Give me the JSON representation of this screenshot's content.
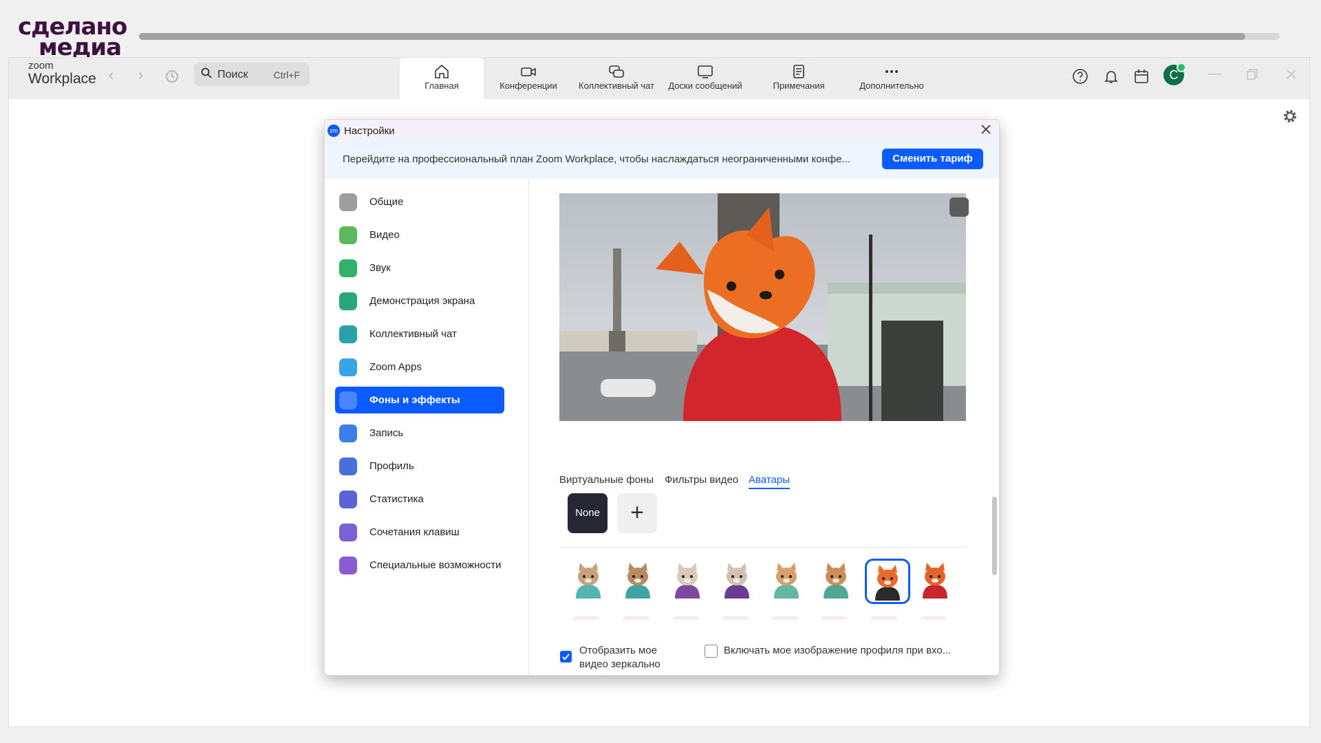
{
  "watermark": {
    "line1": "сделано",
    "line2": "медиа"
  },
  "video_progress": 0.97,
  "app": {
    "brand_small": "zoom",
    "brand_big": "Workplace"
  },
  "search": {
    "placeholder": "Поиск",
    "shortcut": "Ctrl+F"
  },
  "tabs": [
    {
      "label": "Главная",
      "icon": "home-icon"
    },
    {
      "label": "Конференции",
      "icon": "video-camera-icon"
    },
    {
      "label": "Коллективный чат",
      "icon": "chat-icon"
    },
    {
      "label": "Доски сообщений",
      "icon": "whiteboard-icon"
    },
    {
      "label": "Примечания",
      "icon": "notes-icon"
    },
    {
      "label": "Дополнительно",
      "icon": "more-icon"
    }
  ],
  "user": {
    "initial": "C"
  },
  "dialog": {
    "title": "Настройки",
    "banner_text": "Перейдите на профессиональный план Zoom Workplace, чтобы наслаждаться неограниченными конфе...",
    "upgrade_button": "Сменить тариф"
  },
  "sidebar": [
    {
      "label": "Общие",
      "icon": "gear-icon",
      "color": "#9e9e9e"
    },
    {
      "label": "Видео",
      "icon": "video-icon",
      "color": "#5cb85c"
    },
    {
      "label": "Звук",
      "icon": "headphones-icon",
      "color": "#2fb36b"
    },
    {
      "label": "Демонстрация экрана",
      "icon": "screen-share-icon",
      "color": "#27a878"
    },
    {
      "label": "Коллективный чат",
      "icon": "chat-icon",
      "color": "#2aa0a8"
    },
    {
      "label": "Zoom Apps",
      "icon": "apps-icon",
      "color": "#3aa3e8"
    },
    {
      "label": "Фоны и эффекты",
      "icon": "background-icon",
      "color": "#0b5cff",
      "active": true
    },
    {
      "label": "Запись",
      "icon": "record-icon",
      "color": "#3d7fe8"
    },
    {
      "label": "Профиль",
      "icon": "profile-icon",
      "color": "#4a6fd8"
    },
    {
      "label": "Статистика",
      "icon": "statistics-icon",
      "color": "#5b63d8"
    },
    {
      "label": "Сочетания клавиш",
      "icon": "keyboard-icon",
      "color": "#7a62d6"
    },
    {
      "label": "Специальные возможности",
      "icon": "accessibility-icon",
      "color": "#8a5ad0"
    }
  ],
  "bg_tabs": [
    {
      "label": "Виртуальные фоны"
    },
    {
      "label": "Фильтры видео"
    },
    {
      "label": "Аватары",
      "active": true
    }
  ],
  "avatar_none": "None",
  "avatars": [
    {
      "name": "cat-avatar",
      "head": "#c9a27a",
      "body": "#52b6b0"
    },
    {
      "name": "cat-avatar",
      "head": "#b98a62",
      "body": "#3fa5a4"
    },
    {
      "name": "cow-avatar",
      "head": "#d8c9b8",
      "body": "#7b4aa0"
    },
    {
      "name": "cow-avatar",
      "head": "#d1c1ae",
      "body": "#6a3d92"
    },
    {
      "name": "dog-avatar",
      "head": "#d8a066",
      "body": "#62b6a2"
    },
    {
      "name": "dog-avatar",
      "head": "#cc8e56",
      "body": "#4ea894"
    },
    {
      "name": "fox-avatar",
      "head": "#ea6a2c",
      "body": "#2a2a2a",
      "selected": true
    },
    {
      "name": "fox-avatar",
      "head": "#e5622a",
      "body": "#c9262b"
    }
  ],
  "options": {
    "mirror": {
      "label": "Отобразить мое видео зеркально",
      "checked": true
    },
    "profile_pic": {
      "label": "Включать мое изображение профиля при вхо...",
      "checked": false
    }
  }
}
